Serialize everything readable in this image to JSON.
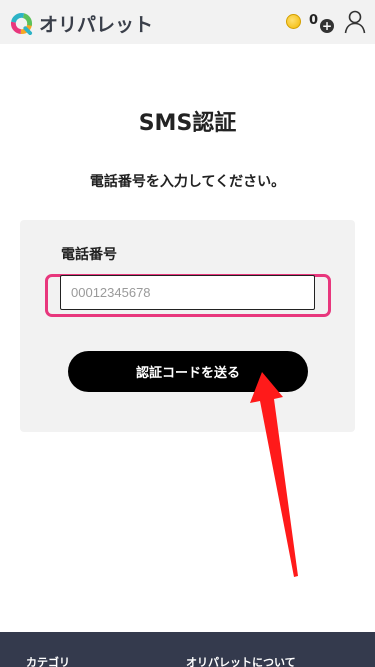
{
  "header": {
    "logo_text": "オリパレット",
    "coin_count": "0",
    "plus_label": "+"
  },
  "main": {
    "title": "SMS認証",
    "instruction": "電話番号を入力してください。",
    "phone_field": {
      "label": "電話番号",
      "placeholder": "00012345678",
      "value": ""
    },
    "send_button_label": "認証コードを送る"
  },
  "footer": {
    "category_label": "カテゴリ",
    "about_label": "オリパレットについて"
  },
  "colors": {
    "header_bg": "#f2f2f2",
    "card_bg": "#f2f2f2",
    "button_bg": "#000000",
    "highlight": "#e8377d",
    "arrow": "#ff1a1a",
    "footer_bg": "#343a4d",
    "coin": "#f2b800"
  },
  "icons": [
    "logo-mark-icon",
    "coin-icon",
    "plus-icon",
    "user-icon",
    "arrow-annotation"
  ]
}
